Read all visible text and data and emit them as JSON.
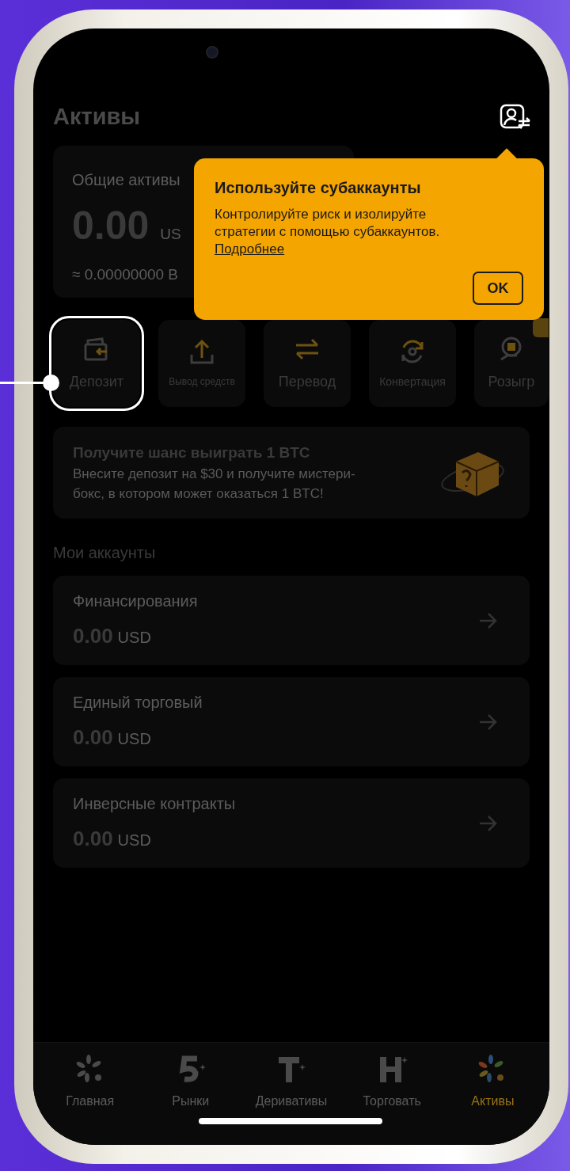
{
  "screen": {
    "title": "Активы"
  },
  "summary": {
    "label": "Общие активы",
    "amount": "0.00",
    "currency": "US",
    "approx": "≈ 0.00000000 B"
  },
  "tooltip": {
    "title": "Используйте субаккаунты",
    "body": "Контролируйте риск и изолируйте стратегии с помощью субаккаунтов.",
    "link": "Подробнее",
    "button": "OK"
  },
  "actions": [
    {
      "kind": "deposit",
      "label": "Депозит",
      "highlighted": true
    },
    {
      "kind": "withdraw",
      "label": "Вывод средств",
      "highlighted": false
    },
    {
      "kind": "transfer",
      "label": "Перевод",
      "highlighted": false
    },
    {
      "kind": "convert",
      "label": "Конвертация",
      "highlighted": false
    },
    {
      "kind": "raffle",
      "label": "Розыгр",
      "highlighted": false
    }
  ],
  "promo": {
    "title": "Получите шанс выиграть 1 BTC",
    "text": "Внесите депозит на $30 и получите мистери-бокс, в котором может оказаться 1 BTC!"
  },
  "accounts_heading": "Мои аккаунты",
  "accounts": [
    {
      "name": "Финансирования",
      "amount": "0.00",
      "currency": "USD"
    },
    {
      "name": "Единый торговый",
      "amount": "0.00",
      "currency": "USD"
    },
    {
      "name": "Инверсные контракты",
      "amount": "0.00",
      "currency": "USD"
    }
  ],
  "nav": [
    {
      "kind": "home",
      "label": "Главная",
      "selected": false
    },
    {
      "kind": "markets",
      "label": "Рынки",
      "selected": false
    },
    {
      "kind": "derivatives",
      "label": "Деривативы",
      "selected": false
    },
    {
      "kind": "trade",
      "label": "Торговать",
      "selected": false
    },
    {
      "kind": "assets",
      "label": "Активы",
      "selected": true
    }
  ]
}
